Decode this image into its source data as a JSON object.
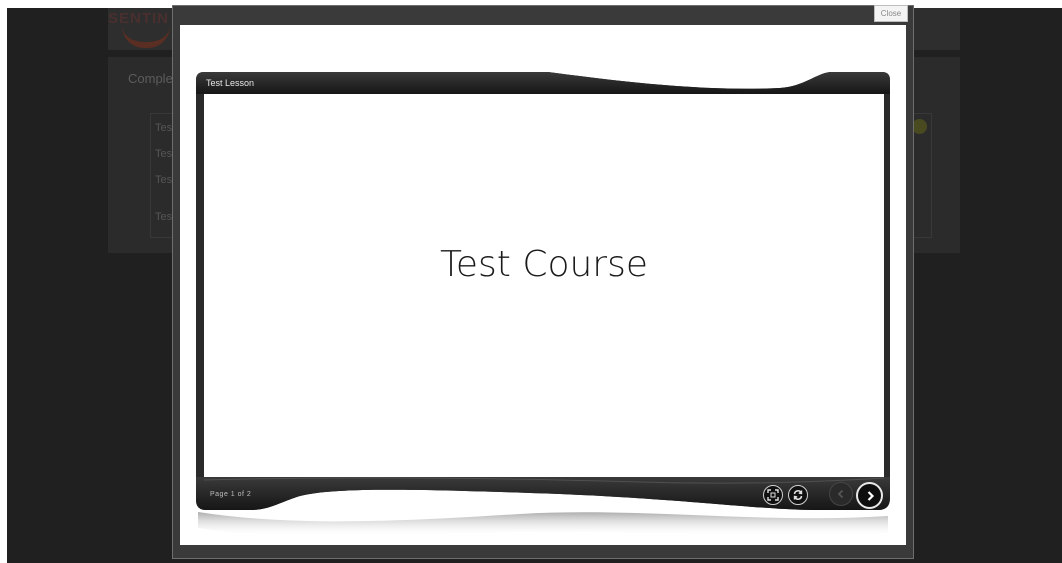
{
  "background_page": {
    "logo_text": "SENTIN",
    "panel_title": "Comple",
    "rows": [
      "Tes",
      "Tes",
      "Tes",
      "Tes"
    ]
  },
  "lightbox": {
    "close_label": "Close"
  },
  "player": {
    "lesson_title": "Test Lesson",
    "slide_title": "Test Course",
    "page_label": "Page 1 of 2",
    "controls": {
      "fullscreen_icon": "fullscreen-icon",
      "replay_icon": "refresh-icon",
      "prev_icon": "chevron-left-icon",
      "next_icon": "chevron-right-icon"
    }
  }
}
